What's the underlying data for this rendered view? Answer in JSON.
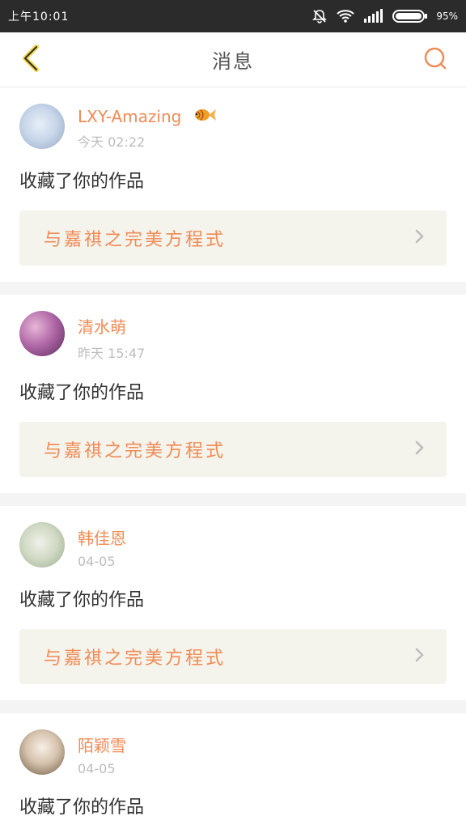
{
  "status_bar": {
    "time": "上午10:01",
    "battery_percent": "95%",
    "icons": [
      "mute-bell-icon",
      "wifi-icon",
      "signal-icon",
      "battery-icon"
    ]
  },
  "header": {
    "title": "消息",
    "back_icon": "chevron-left-icon",
    "search_icon": "search-icon"
  },
  "messages": [
    {
      "username": "LXY-Amazing",
      "badge_icon": "goldfish-icon",
      "time": "今天 02:22",
      "action": "收藏了你的作品",
      "work_title": "与嘉祺之完美方程式"
    },
    {
      "username": "清水萌",
      "time": "昨天 15:47",
      "action": "收藏了你的作品",
      "work_title": "与嘉祺之完美方程式"
    },
    {
      "username": "韩佳恩",
      "time": "04-05",
      "action": "收藏了你的作品",
      "work_title": "与嘉祺之完美方程式"
    },
    {
      "username": "陌颖雪",
      "time": "04-05",
      "action": "收藏了你的作品"
    }
  ],
  "colors": {
    "accent": "#f08b55",
    "status_bar_bg": "#2b2b2b",
    "work_box_bg": "#f4f3ec"
  }
}
